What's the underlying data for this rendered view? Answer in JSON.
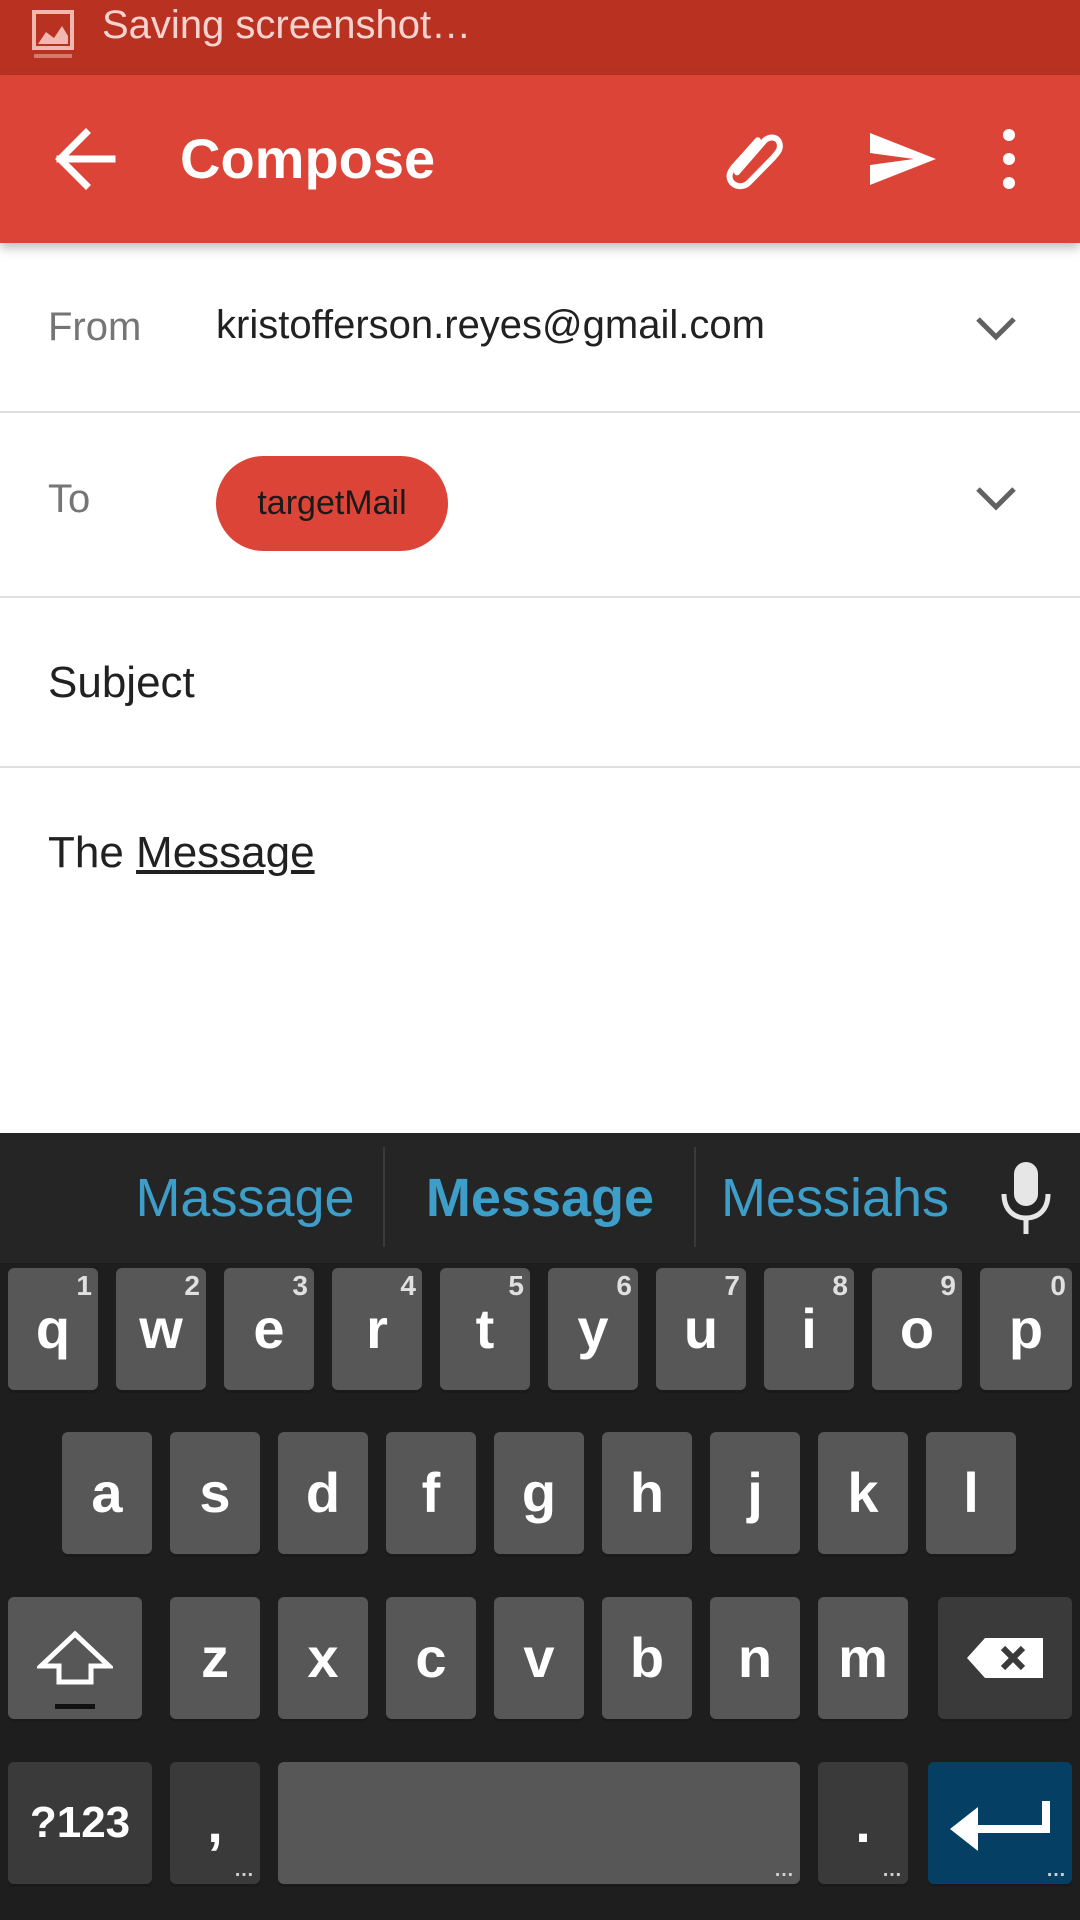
{
  "status_bar": {
    "notification": "Saving screenshot…",
    "icon": "image-icon"
  },
  "app_bar": {
    "title": "Compose",
    "back_icon": "arrow-back-icon",
    "attach_icon": "paperclip-icon",
    "send_icon": "send-icon",
    "more_icon": "more-vert-icon",
    "color": "#db4437"
  },
  "compose": {
    "from_label": "From",
    "from_value": "kristofferson.reyes@gmail.com",
    "to_label": "To",
    "to_chip": "targetMail",
    "subject_placeholder": "Subject",
    "body_text_plain": "The ",
    "body_text_underlined": "Message"
  },
  "keyboard": {
    "suggestions": [
      "Massage",
      "Message",
      "Messiahs"
    ],
    "row1": [
      {
        "key": "q",
        "hint": "1"
      },
      {
        "key": "w",
        "hint": "2"
      },
      {
        "key": "e",
        "hint": "3"
      },
      {
        "key": "r",
        "hint": "4"
      },
      {
        "key": "t",
        "hint": "5"
      },
      {
        "key": "y",
        "hint": "6"
      },
      {
        "key": "u",
        "hint": "7"
      },
      {
        "key": "i",
        "hint": "8"
      },
      {
        "key": "o",
        "hint": "9"
      },
      {
        "key": "p",
        "hint": "0"
      }
    ],
    "row2": [
      "a",
      "s",
      "d",
      "f",
      "g",
      "h",
      "j",
      "k",
      "l"
    ],
    "row3": [
      "z",
      "x",
      "c",
      "v",
      "b",
      "n",
      "m"
    ],
    "symbols_key": "?123",
    "comma_key": ",",
    "period_key": ".",
    "more_dots": "…",
    "accent_color": "#3d9fc9"
  }
}
